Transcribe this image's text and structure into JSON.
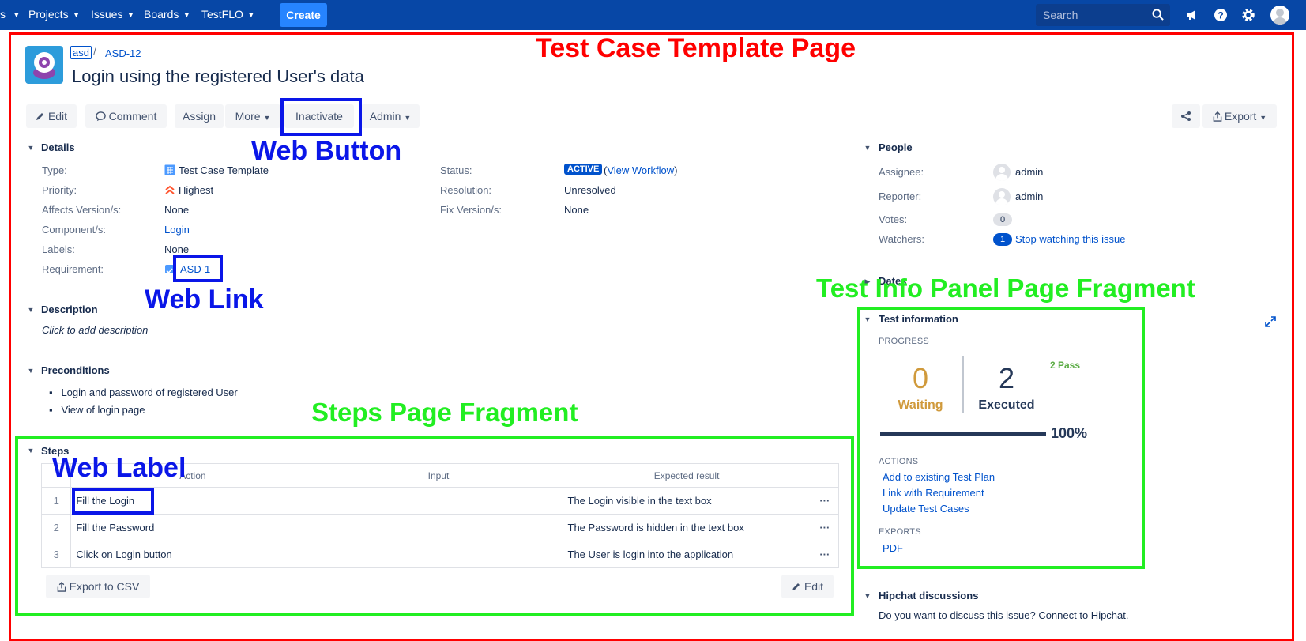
{
  "nav": {
    "items": [
      "Projects",
      "Issues",
      "Boards",
      "TestFLO"
    ],
    "create": "Create",
    "search_placeholder": "Search"
  },
  "issue": {
    "project_key": "asd",
    "key": "ASD-12",
    "title": "Login using the registered User's data"
  },
  "toolbar": {
    "edit": "Edit",
    "comment": "Comment",
    "assign": "Assign",
    "more": "More",
    "inactivate": "Inactivate",
    "admin": "Admin",
    "export": "Export"
  },
  "details": {
    "heading": "Details",
    "type_label": "Type:",
    "type_value": "Test Case Template",
    "priority_label": "Priority:",
    "priority_value": "Highest",
    "affects_label": "Affects Version/s:",
    "affects_value": "None",
    "component_label": "Component/s:",
    "component_value": "Login",
    "labels_label": "Labels:",
    "labels_value": "None",
    "requirement_label": "Requirement:",
    "requirement_value": "ASD-1",
    "status_label": "Status:",
    "status_value": "ACTIVE",
    "workflow_link": "View Workflow",
    "resolution_label": "Resolution:",
    "resolution_value": "Unresolved",
    "fix_label": "Fix Version/s:",
    "fix_value": "None"
  },
  "description": {
    "heading": "Description",
    "placeholder": "Click to add description"
  },
  "preconditions": {
    "heading": "Preconditions",
    "items": [
      "Login and password of registered User",
      "View of login page"
    ]
  },
  "steps": {
    "heading": "Steps",
    "columns": [
      "Action",
      "Input",
      "Expected result"
    ],
    "rows": [
      {
        "num": "1",
        "action": "Fill the Login",
        "input": "",
        "expected": "The Login visible in the text box"
      },
      {
        "num": "2",
        "action": "Fill the Password",
        "input": "",
        "expected": "The Password is hidden in the text box"
      },
      {
        "num": "3",
        "action": "Click on Login button",
        "input": "",
        "expected": "The User is login into the application"
      }
    ],
    "export_csv": "Export to CSV",
    "edit": "Edit"
  },
  "people": {
    "heading": "People",
    "assignee_label": "Assignee:",
    "assignee": "admin",
    "reporter_label": "Reporter:",
    "reporter": "admin",
    "votes_label": "Votes:",
    "votes": "0",
    "watchers_label": "Watchers:",
    "watchers": "1",
    "watch_link": "Stop watching this issue"
  },
  "dates": {
    "heading": "Dates"
  },
  "test_info": {
    "heading": "Test information",
    "progress_label": "PROGRESS",
    "waiting_count": "0",
    "waiting_label": "Waiting",
    "executed_count": "2",
    "executed_label": "Executed",
    "pass_label": "2 Pass",
    "percent": "100%",
    "progress_fraction": 1.0,
    "actions_label": "ACTIONS",
    "actions": [
      "Add to existing Test Plan",
      "Link with Requirement",
      "Update Test Cases"
    ],
    "exports_label": "EXPORTS",
    "exports": [
      "PDF"
    ]
  },
  "hipchat": {
    "heading": "Hipchat discussions",
    "text": "Do you want to discuss this issue? Connect to Hipchat."
  },
  "annotations": {
    "page": "Test Case Template Page",
    "web_button": "Web Button",
    "web_link": "Web Link",
    "web_label": "Web Label",
    "steps_fragment": "Steps Page Fragment",
    "info_fragment": "Test Info Panel Page Fragment"
  },
  "colors": {
    "nav_bg": "#0747a6",
    "create_bg": "#2684ff",
    "status_badge": "#0052cc",
    "waiting": "#d09a3c",
    "executed": "#253858",
    "pass": "#36b37e",
    "annotation_red": "#ff0000",
    "annotation_blue": "#0a16e8",
    "annotation_green": "#22ee22"
  }
}
